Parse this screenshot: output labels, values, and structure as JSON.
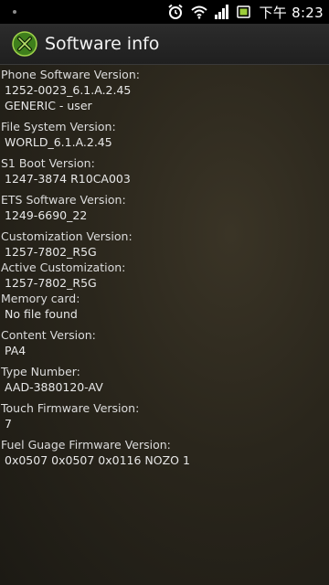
{
  "status_bar": {
    "time": "下午 8:23"
  },
  "action_bar": {
    "title": "Software info"
  },
  "items": [
    {
      "label": "Phone Software Version:",
      "values": [
        "1252-0023_6.1.A.2.45",
        "GENERIC - user"
      ]
    },
    {
      "label": "File System Version:",
      "values": [
        "WORLD_6.1.A.2.45"
      ]
    },
    {
      "label": "S1 Boot Version:",
      "values": [
        "1247-3874 R10CA003"
      ]
    },
    {
      "label": "ETS Software Version:",
      "values": [
        "1249-6690_22"
      ]
    },
    {
      "label": "Customization Version:",
      "values": [
        "1257-7802_R5G"
      ]
    },
    {
      "label": "Active Customization:",
      "values": [
        "1257-7802_R5G"
      ]
    },
    {
      "label": "Memory card:",
      "values": [
        "No file found"
      ]
    },
    {
      "label": "Content Version:",
      "values": [
        "PA4"
      ]
    },
    {
      "label": "Type Number:",
      "values": [
        "AAD-3880120-AV"
      ]
    },
    {
      "label": "Touch Firmware Version:",
      "values": [
        "7"
      ]
    },
    {
      "label": "Fuel Guage Firmware Version:",
      "values": [
        "0x0507 0x0507 0x0116 NOZO 1"
      ]
    }
  ],
  "icons": {
    "status_left": "notification-dot-icon",
    "alarm": "alarm-clock-icon",
    "wifi": "wifi-icon",
    "signal": "signal-strength-icon",
    "battery": "battery-icon",
    "app": "tools-app-icon"
  }
}
